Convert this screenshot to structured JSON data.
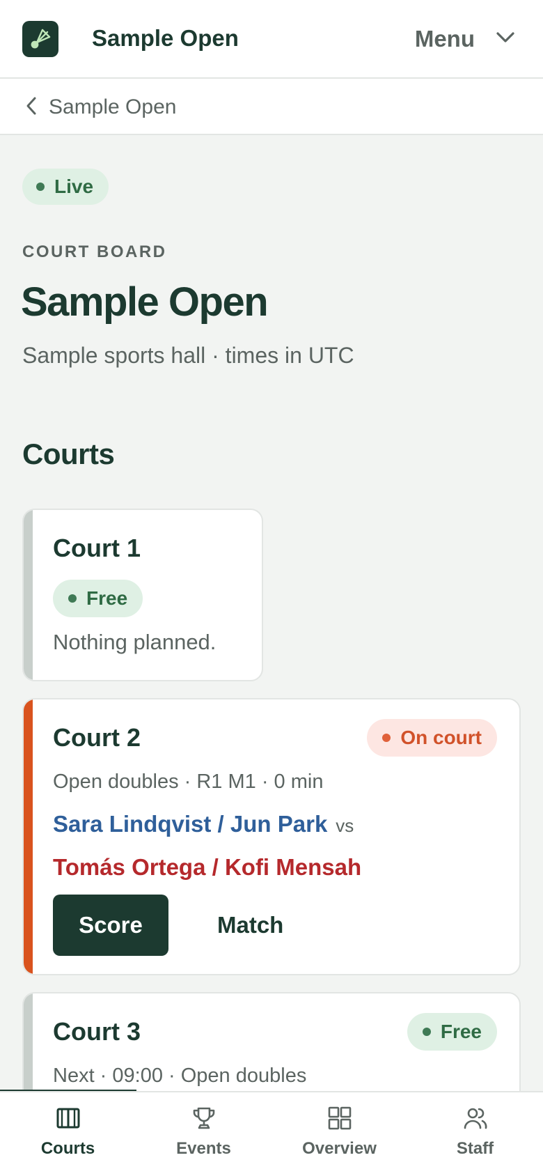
{
  "header": {
    "app_title": "Sample Open",
    "menu_label": "Menu",
    "logo_icon": "shuttlecock-icon",
    "menu_icon": "chevron-down-icon"
  },
  "breadcrumb": {
    "label": "Sample Open",
    "icon": "chevron-left-icon"
  },
  "status": {
    "label": "Live"
  },
  "page": {
    "eyebrow": "COURT BOARD",
    "title": "Sample Open",
    "subtitle": "Sample sports hall · times in UTC",
    "section_title": "Courts"
  },
  "courts": [
    {
      "name": "Court 1",
      "status": "Free",
      "status_type": "free",
      "note": "Nothing planned."
    },
    {
      "name": "Court 2",
      "status": "On court",
      "status_type": "on-court",
      "meta": "Open doubles · R1 M1 · 0 min",
      "team_a": "Sara Lindqvist / Jun Park",
      "vs": "vs",
      "team_b": "Tomás Ortega / Kofi Mensah",
      "primary_action": "Score",
      "secondary_action": "Match"
    },
    {
      "name": "Court 3",
      "status": "Free",
      "status_type": "free",
      "meta": "Next · 09:00 · Open doubles"
    }
  ],
  "bottom_nav": {
    "active": "Courts",
    "items": [
      {
        "label": "Courts",
        "icon": "court-icon"
      },
      {
        "label": "Events",
        "icon": "trophy-icon"
      },
      {
        "label": "Overview",
        "icon": "grid-icon"
      },
      {
        "label": "Staff",
        "icon": "people-icon"
      }
    ]
  },
  "colors": {
    "brand_dark": "#1c3a30",
    "free_bg": "#dff0e4",
    "free_fg": "#2f6b44",
    "on_court_bg": "#fde6e2",
    "on_court_fg": "#d1522a",
    "team_a": "#2f5f9a",
    "team_b": "#b5292c",
    "stripe_active": "#d9531e",
    "stripe_idle": "#c8cfcb"
  }
}
